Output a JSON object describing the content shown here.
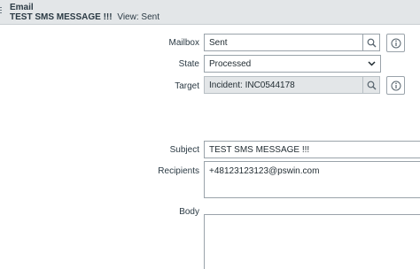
{
  "header": {
    "record_type": "Email",
    "title": "TEST SMS MESSAGE !!!",
    "view_label": "View: Sent"
  },
  "form": {
    "mailbox": {
      "label": "Mailbox",
      "value": "Sent"
    },
    "state": {
      "label": "State",
      "value": "Processed"
    },
    "target": {
      "label": "Target",
      "value": "Incident: INC0544178"
    },
    "subject": {
      "label": "Subject",
      "value": "TEST SMS MESSAGE !!!"
    },
    "recipients": {
      "label": "Recipients",
      "value": "+48123123123@pswin.com"
    },
    "body": {
      "label": "Body",
      "value": ""
    }
  },
  "icons": {
    "lookup": "search-icon",
    "info": "info-icon",
    "dropdown": "chevron-down-icon"
  }
}
